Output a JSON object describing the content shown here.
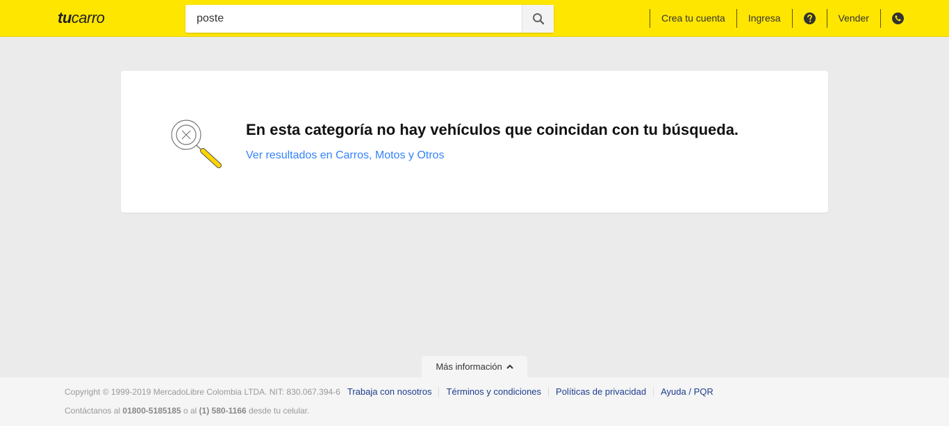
{
  "header": {
    "logo_bold": "tu",
    "logo_regular": "carro",
    "search": {
      "value": "poste",
      "placeholder": ""
    },
    "nav": {
      "create_account": "Crea tu cuenta",
      "login": "Ingresa",
      "sell": "Vender"
    }
  },
  "results": {
    "empty_title": "En esta categoría no hay vehículos que coincidan con tu búsqueda.",
    "alt_link": "Ver resultados en Carros, Motos y Otros"
  },
  "more_info": {
    "label": "Más información"
  },
  "footer": {
    "copyright": "Copyright © 1999-2019 MercadoLibre Colombia LTDA. NIT: 830.067.394-6",
    "links": [
      "Trabaja con nosotros",
      "Términos y condiciones",
      "Políticas de privacidad",
      "Ayuda / PQR"
    ],
    "contact_prefix": "Contáctanos al",
    "phone_1": "01800-5185185",
    "contact_mid": "o al",
    "phone_2": "(1) 580-1166",
    "contact_suffix": "desde tu celular."
  },
  "colors": {
    "brand_yellow": "#ffe600",
    "link_blue": "#3483fa",
    "footer_link": "#1c3d8e",
    "background": "#ebebeb"
  },
  "icons": {
    "search": "search-icon",
    "help": "help-icon",
    "phone": "phone-icon",
    "chevron": "chevron-up-icon",
    "empty_search": "empty-search-illustration"
  }
}
